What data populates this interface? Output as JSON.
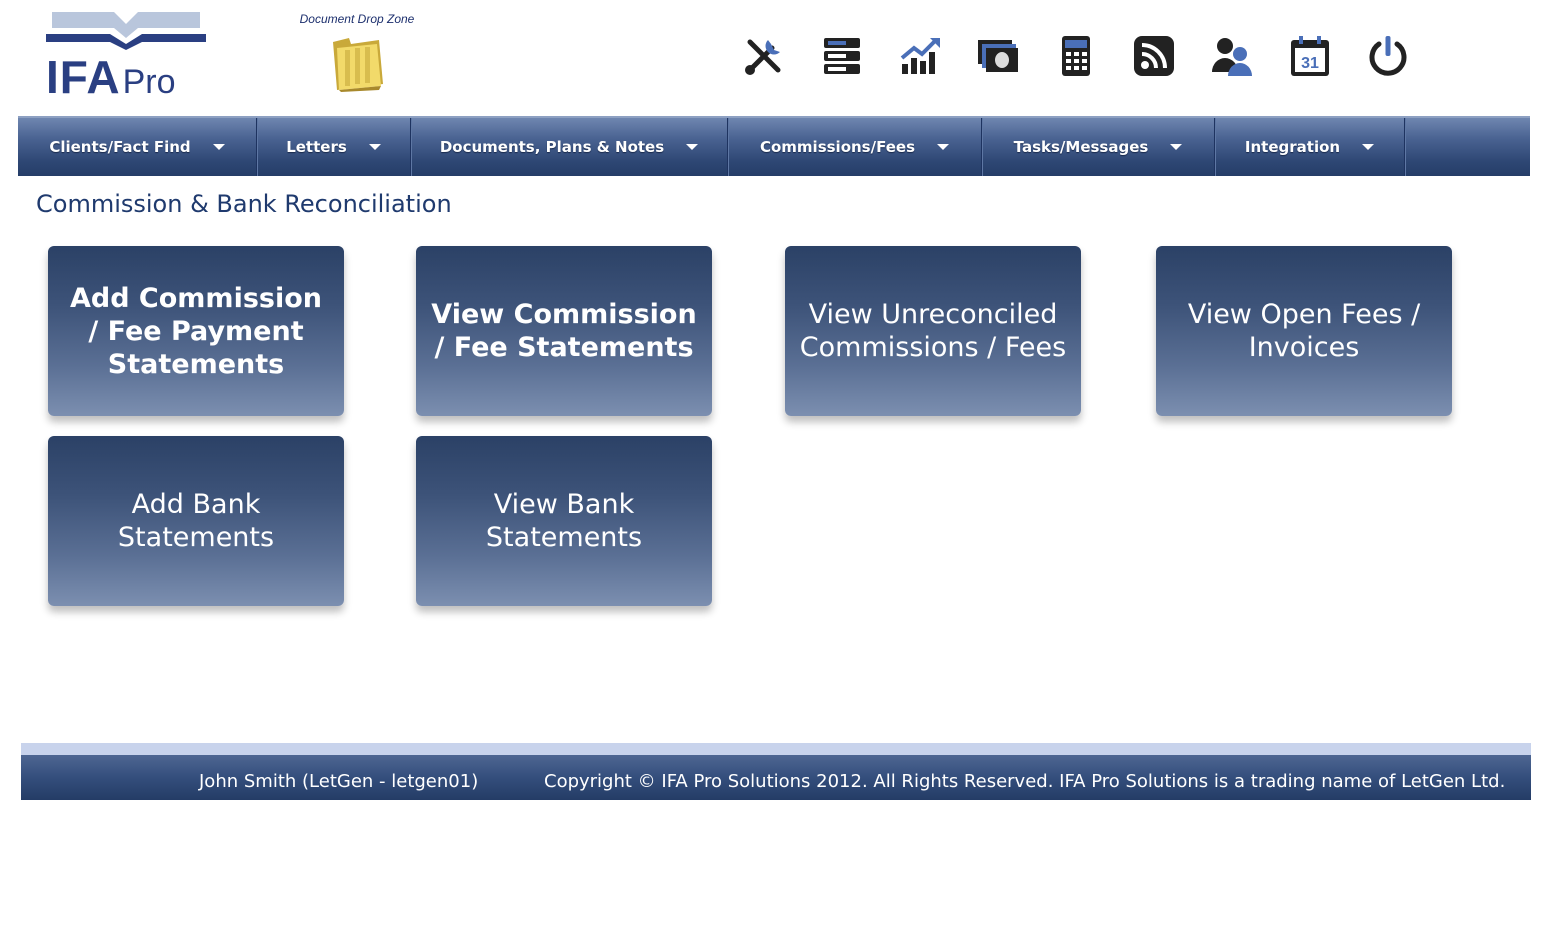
{
  "logo": {
    "ifa": "IFA",
    "pro": "Pro"
  },
  "drop_zone": {
    "label": "Document Drop Zone"
  },
  "toolbar": {
    "icons": [
      "tools-icon",
      "server-icon",
      "chart-icon",
      "money-icon",
      "calculator-icon",
      "rss-icon",
      "users-icon",
      "calendar-icon",
      "power-icon"
    ],
    "calendar_day": "31"
  },
  "nav": {
    "items": [
      {
        "label": "Clients/Fact Find"
      },
      {
        "label": "Letters"
      },
      {
        "label": "Documents, Plans & Notes"
      },
      {
        "label": "Commissions/Fees"
      },
      {
        "label": "Tasks/Messages"
      },
      {
        "label": "Integration"
      }
    ]
  },
  "page": {
    "title": "Commission & Bank Reconciliation"
  },
  "tiles": [
    {
      "label": "Add Commission / Fee Payment Statements"
    },
    {
      "label": "View Commission / Fee Statements"
    },
    {
      "label": "View Unreconciled Commissions / Fees"
    },
    {
      "label": "View Open Fees / Invoices"
    },
    {
      "label": "Add Bank Statements"
    },
    {
      "label": "View Bank Statements"
    }
  ],
  "footer": {
    "user": "John Smith (LetGen - letgen01)",
    "copyright": "Copyright © IFA Pro Solutions 2012. All Rights Reserved. IFA Pro Solutions is a trading name of LetGen Ltd."
  },
  "colors": {
    "brand": "#2a3f82",
    "nav_dark": "#253d68",
    "title": "#1f3a6e",
    "accent_blue": "#4a6fb8"
  }
}
